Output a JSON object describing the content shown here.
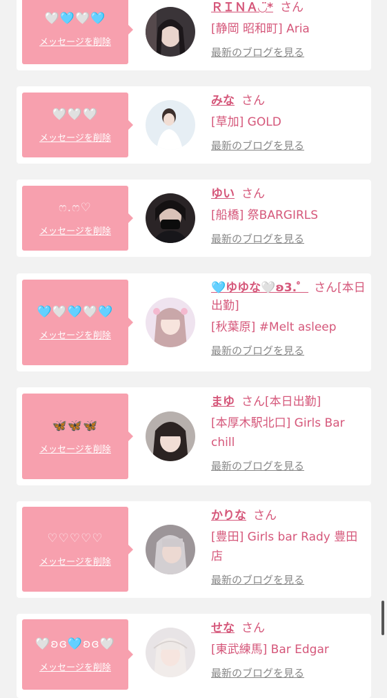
{
  "delete_label": "メッセージを削除",
  "san": "さん",
  "blog_label": "最新のブログを見る",
  "colors": {
    "bubble": "#f7a0ae",
    "name": "#d5577a",
    "link": "#888888",
    "background": "#f2f2f2"
  },
  "entries": [
    {
      "name": "ＲＩＮＡ◡̈*",
      "san_suffix": "さん",
      "shop": "[静岡 昭和町] Aria",
      "message": "🤍🩵🤍🩵",
      "avatar": "avatar-dark-hair-girl"
    },
    {
      "name": "みな",
      "san_suffix": "さん",
      "shop": "[草加] GOLD",
      "message": "🤍🤍🤍",
      "avatar": "avatar-white-dress-girl"
    },
    {
      "name": "ゆい",
      "san_suffix": "さん",
      "shop": "[船橋] 祭BARGIRLS",
      "message": "ෆ.ෆ♡",
      "avatar": "avatar-masked-girl"
    },
    {
      "name": "🩵ゆゆな🤍ʚ3.゜",
      "san_suffix": "さん[本日出勤]",
      "shop": "[秋葉原] #Melt asleep",
      "message": "🩵🤍🩵🤍🩵",
      "avatar": "avatar-idol-girl"
    },
    {
      "name": "まゆ",
      "san_suffix": "さん[本日出勤]",
      "shop": "[本厚木駅北口] Girls Bar chill",
      "message": "🦋🦋🦋",
      "avatar": "avatar-bangs-girl"
    },
    {
      "name": "かりな",
      "san_suffix": "さん",
      "shop": "[豊田] Girls bar Rady 豊田店",
      "message": "♡♡♡♡♡",
      "avatar": "avatar-silver-hair-girl"
    },
    {
      "name": "せな",
      "san_suffix": "さん",
      "shop": "[東武練馬] Bar Edgar",
      "message": "🤍ʚɞ🩵ʚɞ🤍",
      "avatar": "avatar-blonde-girl"
    }
  ]
}
